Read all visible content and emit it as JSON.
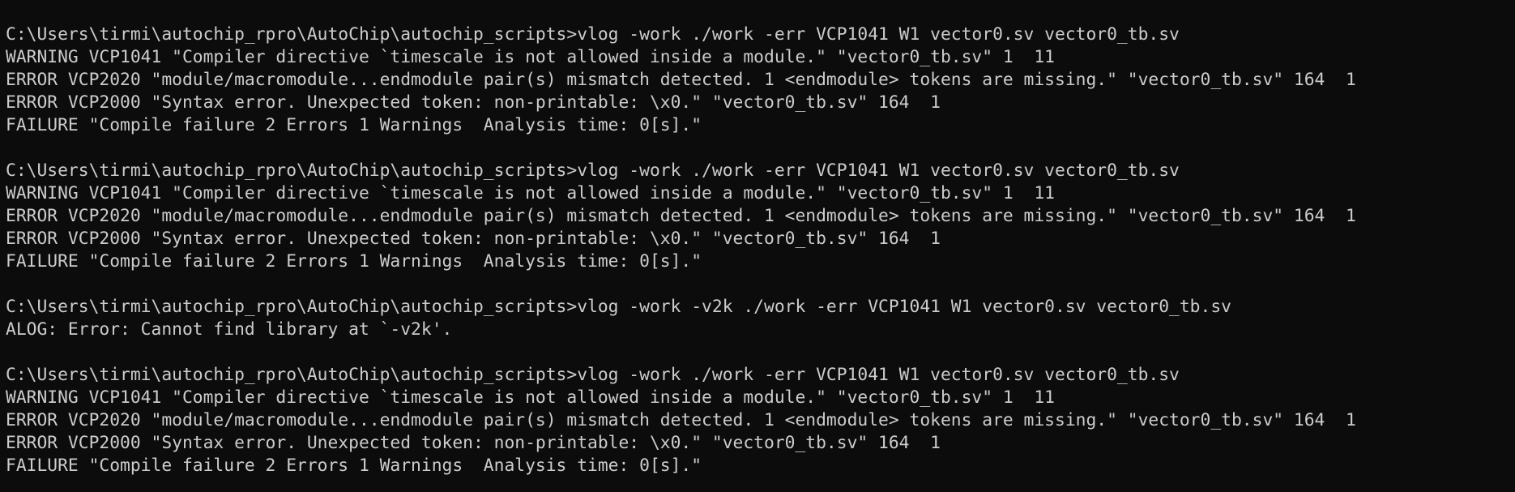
{
  "terminal": {
    "blocks": [
      {
        "lines": [
          "C:\\Users\\tirmi\\autochip_rpro\\AutoChip\\autochip_scripts>vlog -work ./work -err VCP1041 W1 vector0.sv vector0_tb.sv",
          "WARNING VCP1041 \"Compiler directive `timescale is not allowed inside a module.\" \"vector0_tb.sv\" 1  11",
          "ERROR VCP2020 \"module/macromodule...endmodule pair(s) mismatch detected. 1 <endmodule> tokens are missing.\" \"vector0_tb.sv\" 164  1",
          "ERROR VCP2000 \"Syntax error. Unexpected token: non-printable: \\x0.\" \"vector0_tb.sv\" 164  1",
          "FAILURE \"Compile failure 2 Errors 1 Warnings  Analysis time: 0[s].\""
        ]
      },
      {
        "lines": [
          "C:\\Users\\tirmi\\autochip_rpro\\AutoChip\\autochip_scripts>vlog -work ./work -err VCP1041 W1 vector0.sv vector0_tb.sv",
          "WARNING VCP1041 \"Compiler directive `timescale is not allowed inside a module.\" \"vector0_tb.sv\" 1  11",
          "ERROR VCP2020 \"module/macromodule...endmodule pair(s) mismatch detected. 1 <endmodule> tokens are missing.\" \"vector0_tb.sv\" 164  1",
          "ERROR VCP2000 \"Syntax error. Unexpected token: non-printable: \\x0.\" \"vector0_tb.sv\" 164  1",
          "FAILURE \"Compile failure 2 Errors 1 Warnings  Analysis time: 0[s].\""
        ]
      },
      {
        "lines": [
          "C:\\Users\\tirmi\\autochip_rpro\\AutoChip\\autochip_scripts>vlog -work -v2k ./work -err VCP1041 W1 vector0.sv vector0_tb.sv",
          "ALOG: Error: Cannot find library at `-v2k'."
        ]
      },
      {
        "lines": [
          "C:\\Users\\tirmi\\autochip_rpro\\AutoChip\\autochip_scripts>vlog -work ./work -err VCP1041 W1 vector0.sv vector0_tb.sv",
          "WARNING VCP1041 \"Compiler directive `timescale is not allowed inside a module.\" \"vector0_tb.sv\" 1  11",
          "ERROR VCP2020 \"module/macromodule...endmodule pair(s) mismatch detected. 1 <endmodule> tokens are missing.\" \"vector0_tb.sv\" 164  1",
          "ERROR VCP2000 \"Syntax error. Unexpected token: non-printable: \\x0.\" \"vector0_tb.sv\" 164  1",
          "FAILURE \"Compile failure 2 Errors 1 Warnings  Analysis time: 0[s].\""
        ]
      }
    ]
  },
  "colors": {
    "background": "#0c0c0c",
    "foreground": "#cccccc"
  }
}
